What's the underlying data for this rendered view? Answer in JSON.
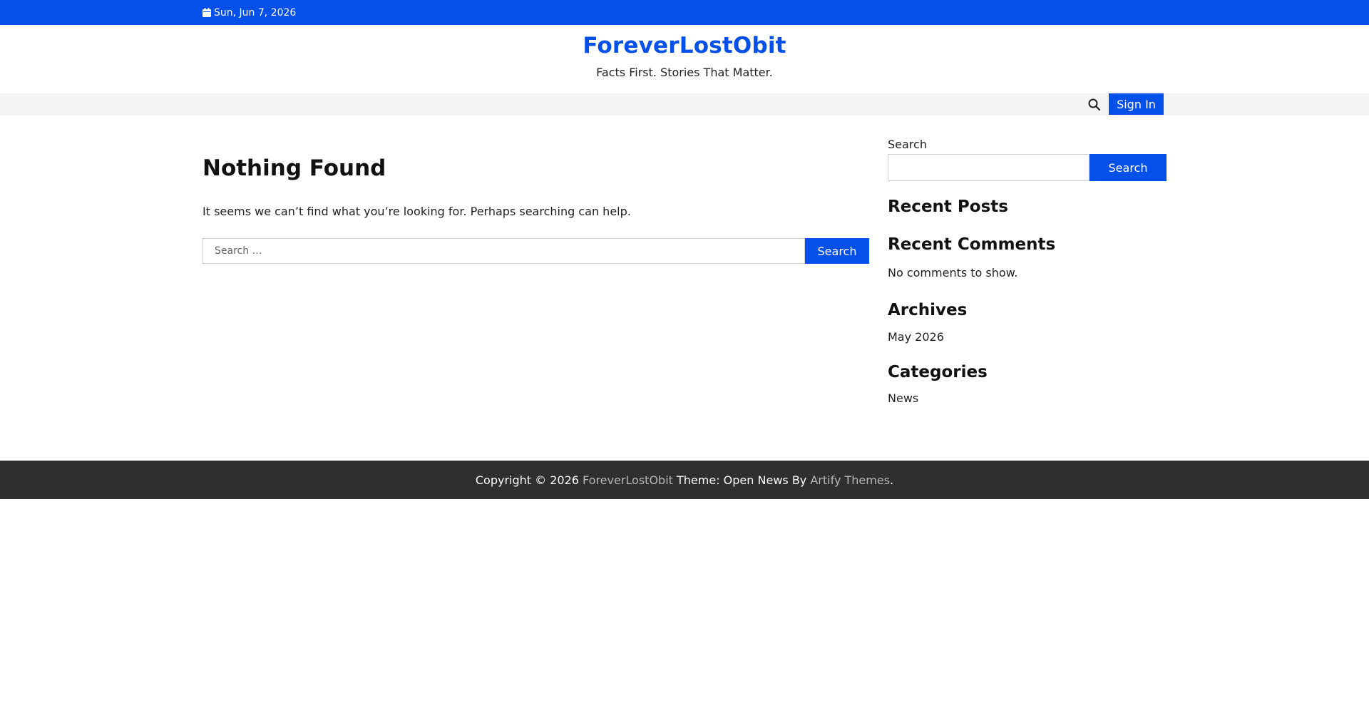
{
  "topbar": {
    "date": "Sun, Jun 7, 2026",
    "date_icon": "calendar-icon"
  },
  "header": {
    "title": "ForeverLostObit",
    "tagline": "Facts First. Stories That Matter."
  },
  "navbar": {
    "search_icon": "search-icon",
    "sign_in_label": "Sign In"
  },
  "main": {
    "title": "Nothing Found",
    "description": "It seems we can’t find what you’re looking for. Perhaps searching can help.",
    "search": {
      "placeholder": "Search …",
      "value": "",
      "button_label": "Search"
    }
  },
  "sidebar": {
    "search_label": "Search",
    "search_value": "",
    "search_button": "Search",
    "recent_posts_title": "Recent Posts",
    "recent_comments_title": "Recent Comments",
    "no_comments_text": "No comments to show.",
    "archives_title": "Archives",
    "archives_items": [
      "May 2026"
    ],
    "categories_title": "Categories",
    "categories_items": [
      "News"
    ]
  },
  "footer": {
    "copyright": "Copyright © 2026",
    "site_link": "ForeverLostObit",
    "theme_text": "Theme: Open News By",
    "theme_link": "Artify Themes",
    "end": "."
  },
  "colors": {
    "accent": "#0450e8",
    "footer_bg": "#2f2f2f",
    "navbar_bg": "#f4f4f4"
  }
}
